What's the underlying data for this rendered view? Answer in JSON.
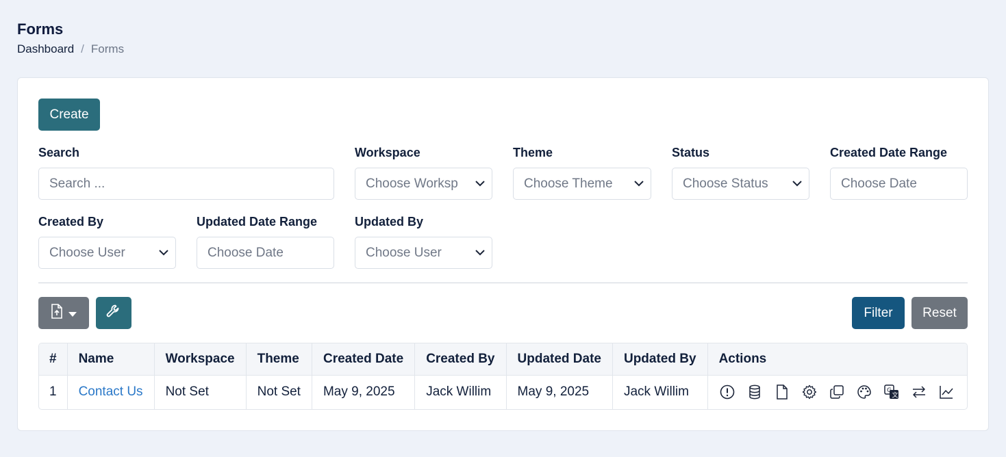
{
  "page": {
    "title": "Forms",
    "breadcrumb": {
      "home": "Dashboard",
      "separator": "/",
      "current": "Forms"
    }
  },
  "toolbar": {
    "create_label": "Create",
    "filter_label": "Filter",
    "reset_label": "Reset"
  },
  "filters": {
    "search": {
      "label": "Search",
      "placeholder": "Search ..."
    },
    "workspace": {
      "label": "Workspace",
      "value": "Choose Worksp"
    },
    "theme": {
      "label": "Theme",
      "value": "Choose Theme"
    },
    "status": {
      "label": "Status",
      "value": "Choose Status"
    },
    "created_range": {
      "label": "Created Date Range",
      "value": "Choose Date"
    },
    "created_by": {
      "label": "Created By",
      "value": "Choose User"
    },
    "updated_range": {
      "label": "Updated Date Range",
      "value": "Choose Date"
    },
    "updated_by": {
      "label": "Updated By",
      "value": "Choose User"
    }
  },
  "table": {
    "headers": [
      "#",
      "Name",
      "Workspace",
      "Theme",
      "Created Date",
      "Created By",
      "Updated Date",
      "Updated By",
      "Actions"
    ],
    "rows": [
      {
        "num": "1",
        "name": "Contact Us",
        "workspace": "Not Set",
        "theme": "Not Set",
        "created_date": "May 9, 2025",
        "created_by": "Jack Willim",
        "updated_date": "May 9, 2025",
        "updated_by": "Jack Willim"
      }
    ],
    "action_icons": [
      "info-icon",
      "database-icon",
      "file-icon",
      "gear-icon",
      "copy-icon",
      "palette-icon",
      "translate-icon",
      "arrows-exchange-icon",
      "chart-line-icon"
    ]
  },
  "colors": {
    "primary": "#2b6d7c",
    "filter": "#15567f",
    "secondary": "#6d747d",
    "link": "#2a78c8"
  }
}
